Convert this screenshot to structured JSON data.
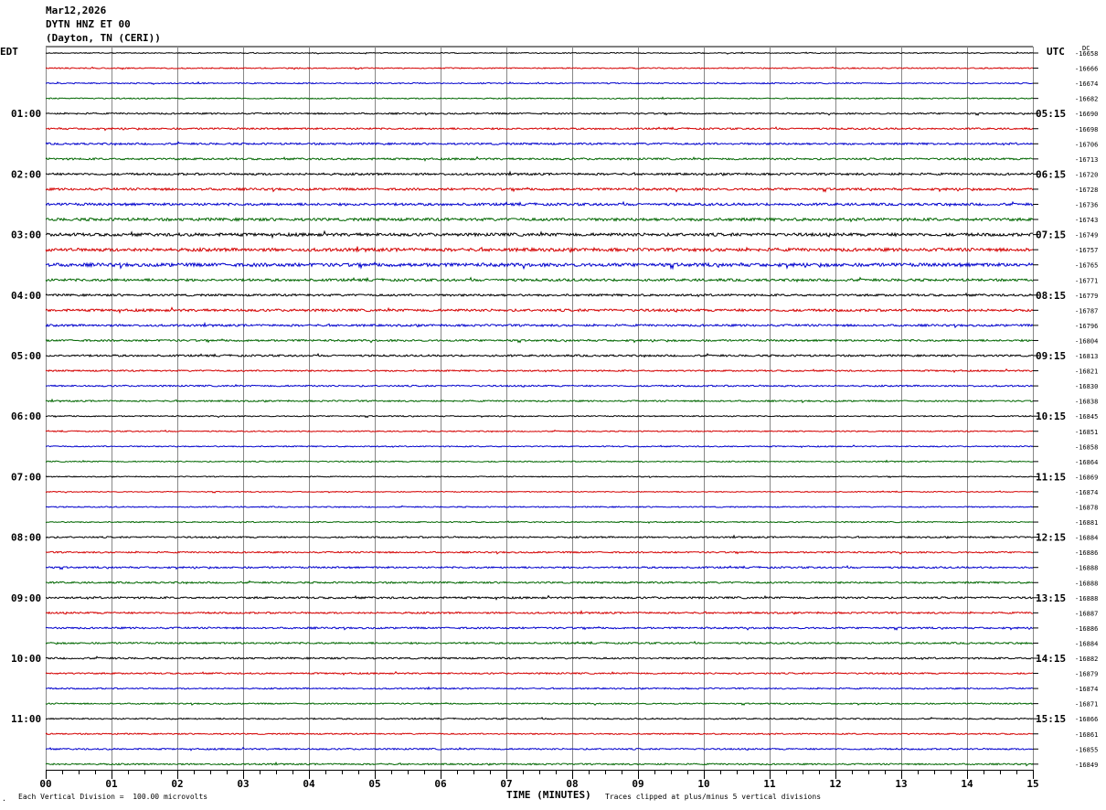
{
  "header": {
    "date": "Mar12,2026",
    "station": "DYTN HNZ ET 00",
    "location": "(Dayton, TN (CERI))"
  },
  "left_axis_label": "EDT",
  "right_axis_label": "UTC",
  "dc_label": "DC",
  "footer": {
    "scale_note": "Each Vertical Division =  100.00 microvolts",
    "x_title": "TIME (MINUTES)",
    "clip_note": "Traces clipped at plus/minus 5 vertical divisions",
    "corner_mark": "."
  },
  "chart_data": {
    "type": "line",
    "title": "",
    "xlabel": "TIME (MINUTES)",
    "ylabel": "",
    "xlim": [
      0,
      15
    ],
    "x_ticks": [
      "00",
      "01",
      "02",
      "03",
      "04",
      "05",
      "06",
      "07",
      "08",
      "09",
      "10",
      "11",
      "12",
      "13",
      "14",
      "15"
    ],
    "grid": true,
    "trace_colors": [
      "#000000",
      "#d40000",
      "#0000cc",
      "#006600"
    ],
    "left_time_labels": [
      "01:00",
      "02:00",
      "03:00",
      "04:00",
      "05:00",
      "06:00",
      "07:00",
      "08:00",
      "09:00",
      "10:00",
      "11:00"
    ],
    "right_time_labels": [
      "05:15",
      "06:15",
      "07:15",
      "08:15",
      "09:15",
      "10:15",
      "11:15",
      "12:15",
      "13:15",
      "14:15",
      "15:15"
    ],
    "trace_dc_values": [
      -16658,
      -16666,
      -16674,
      -16682,
      -16690,
      -16698,
      -16706,
      -16713,
      -16720,
      -16728,
      -16736,
      -16743,
      -16749,
      -16757,
      -16765,
      -16771,
      -16779,
      -16787,
      -16796,
      -16804,
      -16813,
      -16821,
      -16830,
      -16838,
      -16845,
      -16851,
      -16858,
      -16864,
      -16869,
      -16874,
      -16878,
      -16881,
      -16884,
      -16886,
      -16888,
      -16888,
      -16888,
      -16887,
      -16886,
      -16884,
      -16882,
      -16879,
      -16874,
      -16871,
      -16866,
      -16861,
      -16855,
      -16849
    ],
    "trace_noise": [
      0.5,
      0.6,
      0.6,
      0.6,
      0.8,
      0.9,
      1.0,
      1.0,
      1.1,
      1.2,
      1.3,
      1.5,
      1.6,
      1.7,
      1.8,
      1.3,
      1.1,
      1.3,
      1.1,
      1.0,
      1.0,
      0.8,
      0.8,
      0.8,
      0.6,
      0.6,
      0.6,
      0.6,
      0.5,
      0.5,
      0.6,
      0.6,
      0.8,
      0.8,
      0.9,
      0.9,
      1.0,
      0.9,
      0.9,
      0.9,
      0.9,
      0.8,
      0.7,
      0.7,
      0.7,
      0.7,
      0.8,
      0.8
    ]
  }
}
